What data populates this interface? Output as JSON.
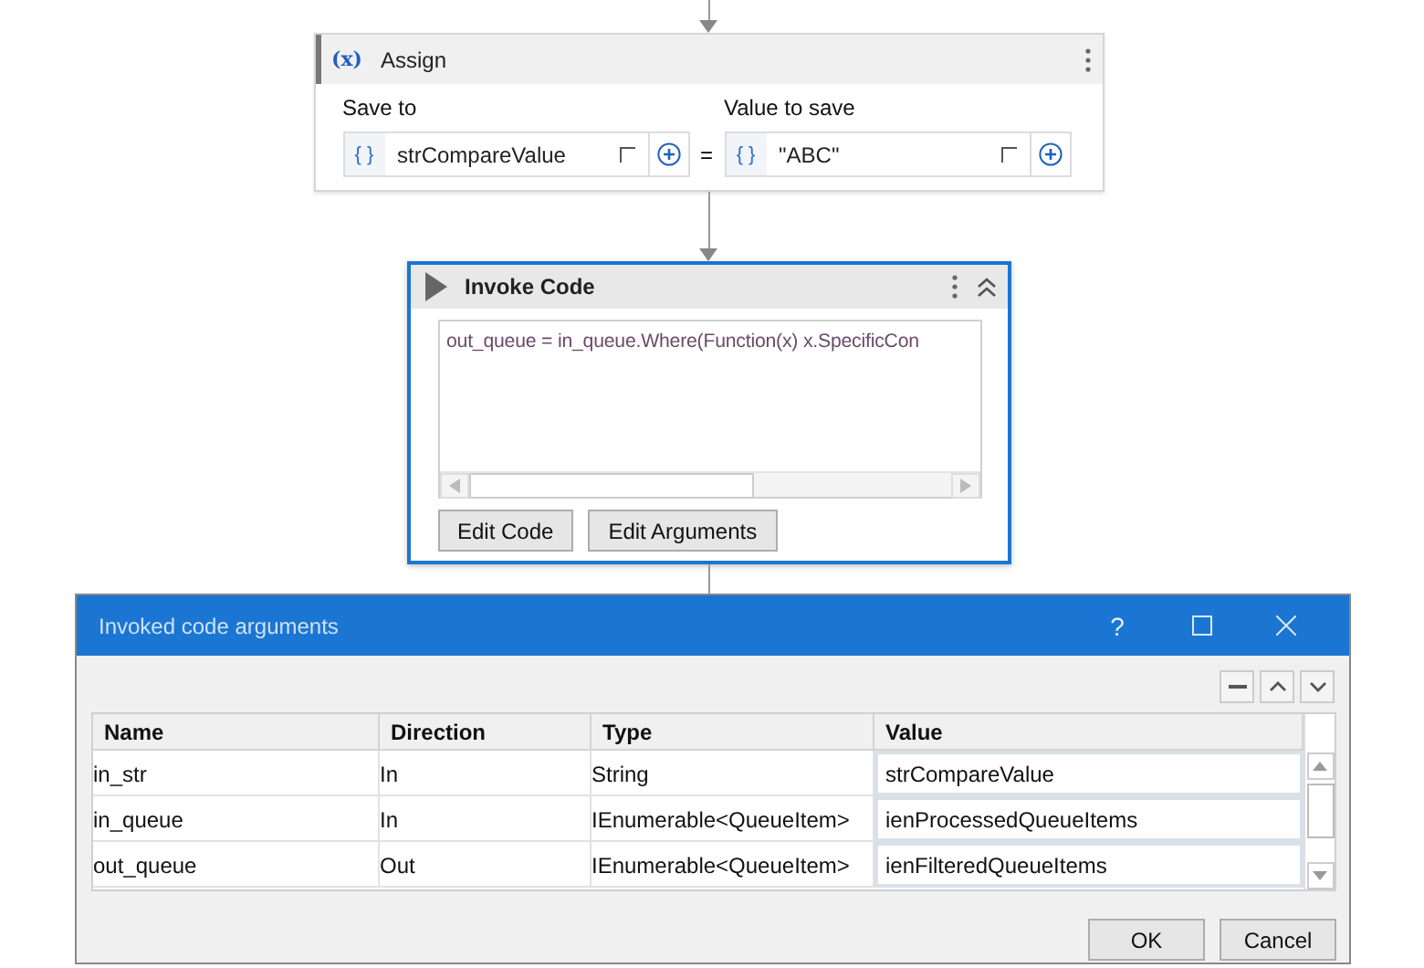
{
  "assign": {
    "icon": "(x)",
    "title": "Assign",
    "save_to": {
      "icon": "{ }",
      "label": "Save to",
      "value": "strCompareValue"
    },
    "operator": "=",
    "value_to_save": {
      "icon": "{ }",
      "label": "Value to save",
      "value": "\"ABC\""
    }
  },
  "invoke_code": {
    "title": "Invoke Code",
    "selected": true,
    "code": "out_queue = in_queue.Where(Function(x) x.SpecificCon",
    "buttons": [
      "Edit Code",
      "Edit Arguments"
    ]
  },
  "dialog": {
    "title": "Invoked code arguments",
    "help": "?",
    "columns": [
      "Name",
      "Direction",
      "Type",
      "Value"
    ],
    "rows": [
      {
        "name": "in_str",
        "direction": "In",
        "type": "String",
        "value": "strCompareValue"
      },
      {
        "name": "in_queue",
        "direction": "In",
        "type": "IEnumerable<QueueItem>",
        "value": "ienProcessedQueueItems"
      },
      {
        "name": "out_queue",
        "direction": "Out",
        "type": "IEnumerable<QueueItem>",
        "value": "ienFilteredQueueItems"
      }
    ],
    "buttons": [
      "OK",
      "Cancel"
    ]
  }
}
